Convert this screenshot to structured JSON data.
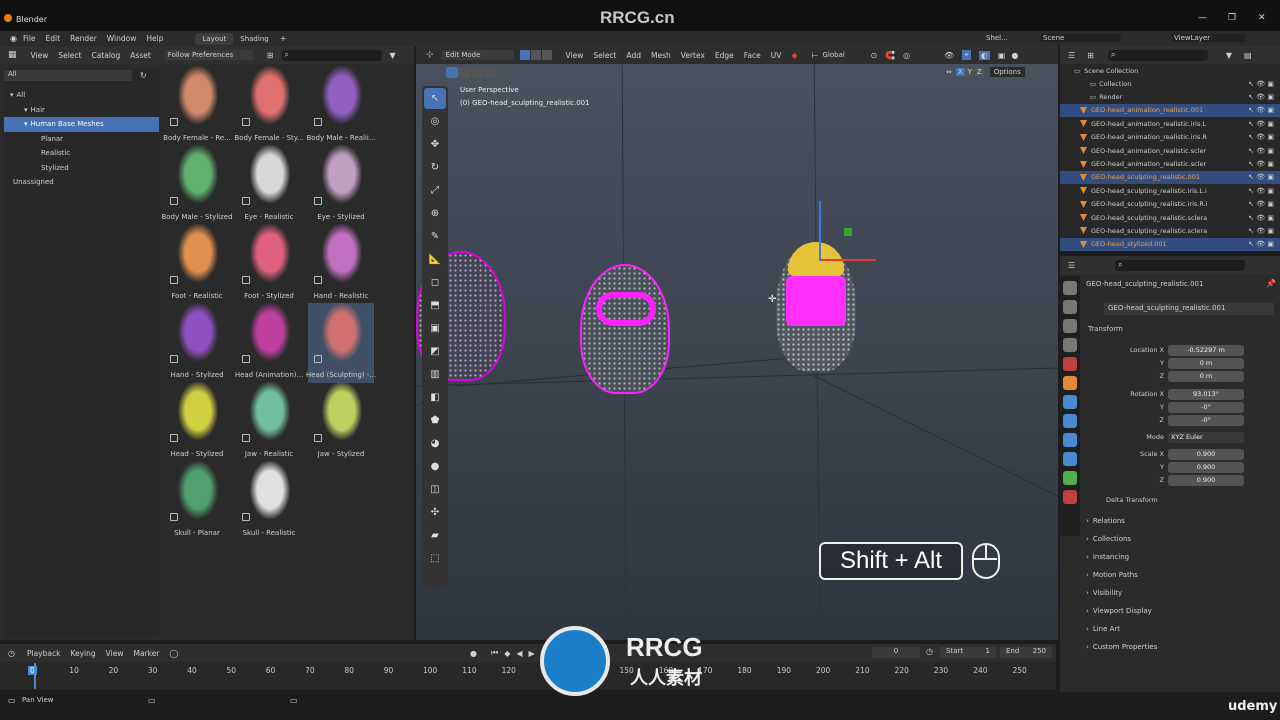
{
  "app": {
    "title": "Blender",
    "watermark": "RRCG.cn",
    "udemy": "udemy"
  },
  "menu": [
    "File",
    "Edit",
    "Render",
    "Window",
    "Help"
  ],
  "workspace_tabs": [
    "Layout",
    "Shading"
  ],
  "top_right": {
    "scene_short": "Shel...",
    "scene": "Scene",
    "view_layer": "ViewLayer"
  },
  "asset_browser": {
    "menu": [
      "View",
      "Select",
      "Catalog",
      "Asset"
    ],
    "follow_prefs": "Follow Preferences",
    "library_filter": "All",
    "catalog_tree": [
      {
        "label": "All",
        "level": 0,
        "selected": false
      },
      {
        "label": "Hair",
        "level": 1,
        "selected": false
      },
      {
        "label": "Human Base Meshes",
        "level": 1,
        "selected": true
      },
      {
        "label": "Planar",
        "level": 2,
        "selected": false
      },
      {
        "label": "Realistic",
        "level": 2,
        "selected": false
      },
      {
        "label": "Stylized",
        "level": 2,
        "selected": false
      },
      {
        "label": "Unassigned",
        "level": 0,
        "selected": false
      }
    ],
    "assets": [
      {
        "label": "Body Female - Re...",
        "color": "#d08a6a",
        "selected": false
      },
      {
        "label": "Body Female - Sty...",
        "color": "#e07070",
        "selected": false
      },
      {
        "label": "Body Male - Realii...",
        "color": "#9060c0",
        "selected": false
      },
      {
        "label": "Body Male - Stylized",
        "color": "#60b070",
        "selected": false
      },
      {
        "label": "Eye - Realistic",
        "color": "#d8d8d8",
        "selected": false
      },
      {
        "label": "Eye - Stylized",
        "color": "#c0a0c0",
        "selected": false
      },
      {
        "label": "Foot - Realistic",
        "color": "#e09050",
        "selected": false
      },
      {
        "label": "Foot - Stylized",
        "color": "#e06080",
        "selected": false
      },
      {
        "label": "Hand - Realistic",
        "color": "#c070c0",
        "selected": false
      },
      {
        "label": "Hand - Stylized",
        "color": "#9050c0",
        "selected": false
      },
      {
        "label": "Head (Animation)...",
        "color": "#c040a0",
        "selected": false
      },
      {
        "label": "Head (Sculpting) -...",
        "color": "#d07070",
        "selected": true
      },
      {
        "label": "Head - Stylized",
        "color": "#d0d040",
        "selected": false
      },
      {
        "label": "Jaw - Realistic",
        "color": "#70c0a0",
        "selected": false
      },
      {
        "label": "Jaw - Stylized",
        "color": "#c0d060",
        "selected": false
      },
      {
        "label": "Skull - Planar",
        "color": "#50a070",
        "selected": false
      },
      {
        "label": "Skull - Realistic",
        "color": "#e0e0e0",
        "selected": false
      }
    ]
  },
  "viewport": {
    "mode": "Edit Mode",
    "menu": [
      "View",
      "Select",
      "Add",
      "Mesh",
      "Vertex",
      "Edge",
      "Face",
      "UV"
    ],
    "orientation": "Global",
    "perspective": "User Perspective",
    "object": "(0) GEO-head_sculpting_realistic.001",
    "options": "Options",
    "axes": [
      "X",
      "Y",
      "Z"
    ],
    "shortcut": "Shift + Alt"
  },
  "outliner": {
    "root": "Scene Collection",
    "rows": [
      {
        "label": "Collection",
        "type": "collection",
        "selected": false
      },
      {
        "label": "Render",
        "type": "collection",
        "selected": false
      },
      {
        "label": "GEO-head_animation_realistic.001",
        "type": "mesh",
        "selected": true
      },
      {
        "label": "GEO-head_animation_realistic.iris.L",
        "type": "mesh",
        "selected": false
      },
      {
        "label": "GEO-head_animation_realistic.iris.R",
        "type": "mesh",
        "selected": false
      },
      {
        "label": "GEO-head_animation_realistic.scler",
        "type": "mesh",
        "selected": false
      },
      {
        "label": "GEO-head_animation_realistic.scler",
        "type": "mesh",
        "selected": false
      },
      {
        "label": "GEO-head_sculpting_realistic.001",
        "type": "mesh",
        "selected": true
      },
      {
        "label": "GEO-head_sculpting_realistic.iris.L.i",
        "type": "mesh",
        "selected": false
      },
      {
        "label": "GEO-head_sculpting_realistic.iris.R.i",
        "type": "mesh",
        "selected": false
      },
      {
        "label": "GEO-head_sculpting_realistic.sclera",
        "type": "mesh",
        "selected": false
      },
      {
        "label": "GEO-head_sculpting_realistic.sclera",
        "type": "mesh",
        "selected": false
      },
      {
        "label": "GEO-head_stylized.001",
        "type": "mesh",
        "selected": true
      }
    ]
  },
  "properties": {
    "object_name": "GEO-head_sculpting_realistic.001",
    "data_name": "GEO-head_sculpting_realistic.001",
    "transform": "Transform",
    "location": {
      "label": "Location X",
      "x": "-0.52297 m",
      "y": "0 m",
      "z": "0 m"
    },
    "rotation": {
      "label": "Rotation X",
      "x": "93.013°",
      "y": "-0°",
      "z": "-0°"
    },
    "mode_label": "Mode",
    "mode": "XYZ Euler",
    "scale": {
      "label": "Scale X",
      "x": "0.900",
      "y": "0.900",
      "z": "0.900"
    },
    "axis_y": "Y",
    "axis_z": "Z",
    "delta": "Delta Transform",
    "sections": [
      "Relations",
      "Collections",
      "Instancing",
      "Motion Paths",
      "Visibility",
      "Viewport Display",
      "Line Art",
      "Custom Properties"
    ]
  },
  "timeline": {
    "menu": [
      "Playback",
      "Keying",
      "View",
      "Marker"
    ],
    "current": "0",
    "start_label": "Start",
    "start": "1",
    "end_label": "End",
    "end": "250",
    "ticks": [
      "0",
      "10",
      "20",
      "30",
      "40",
      "50",
      "60",
      "70",
      "80",
      "90",
      "100",
      "110",
      "120",
      "130",
      "140",
      "150",
      "160",
      "170",
      "180",
      "190",
      "200",
      "210",
      "220",
      "230",
      "240",
      "250"
    ]
  },
  "status": {
    "left": "Pan View"
  },
  "logo": {
    "main": "RRCG",
    "sub": "人人素材"
  }
}
